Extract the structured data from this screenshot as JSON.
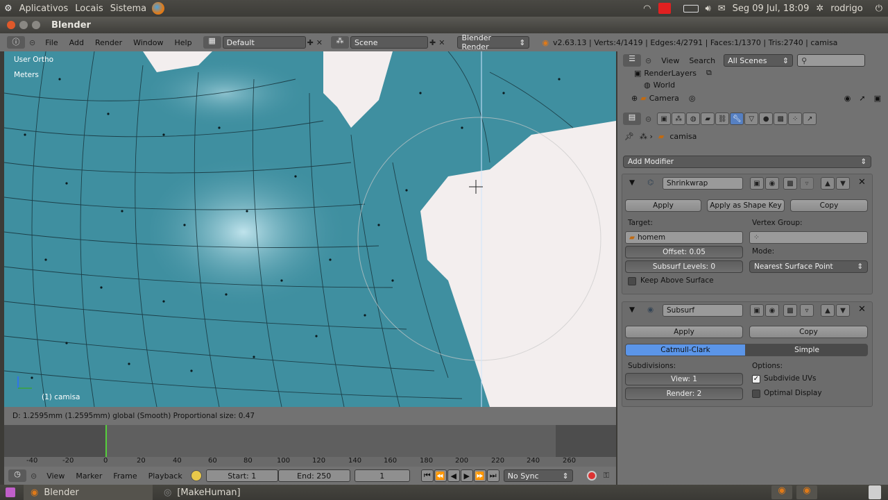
{
  "top_panel": {
    "menus": [
      "Aplicativos",
      "Locais",
      "Sistema"
    ],
    "datetime": "Seg 09 Jul, 18:09",
    "user": "rodrigo"
  },
  "window": {
    "title": "Blender"
  },
  "info_header": {
    "menus": [
      "File",
      "Add",
      "Render",
      "Window",
      "Help"
    ],
    "layout": "Default",
    "scene": "Scene",
    "engine": "Blender Render",
    "stats": "v2.63.13 | Verts:4/1419 | Edges:4/2791 | Faces:1/1370 | Tris:2740 | camisa"
  },
  "viewport": {
    "view_label": "User Ortho",
    "units_label": "Meters",
    "object_label": "(1) camisa",
    "status_text": "D: 1.2595mm  (1.2595mm) global (Smooth)   Proportional size: 0.47",
    "colors": {
      "mesh": "#3f8fa0",
      "body": "#f2ecec"
    }
  },
  "timeline": {
    "ticks": [
      "-40",
      "-20",
      "0",
      "20",
      "40",
      "60",
      "80",
      "100",
      "120",
      "140",
      "160",
      "180",
      "200",
      "220",
      "240",
      "260"
    ],
    "menus": [
      "View",
      "Marker",
      "Frame",
      "Playback"
    ],
    "start": "Start: 1",
    "end": "End: 250",
    "current": "1",
    "sync": "No Sync",
    "current_frame_value": 1
  },
  "outliner": {
    "menus": [
      "View",
      "Search"
    ],
    "filter": "All Scenes",
    "items": [
      "RenderLayers",
      "World",
      "Camera"
    ]
  },
  "properties": {
    "breadcrumb": "camisa",
    "add_modifier": "Add Modifier",
    "shrinkwrap": {
      "name": "Shrinkwrap",
      "apply": "Apply",
      "apply_shape": "Apply as Shape Key",
      "copy": "Copy",
      "target_label": "Target:",
      "target": "homem",
      "vertex_group_label": "Vertex Group:",
      "offset": "Offset: 0.05",
      "subsurf_levels": "Subsurf Levels: 0",
      "mode_label": "Mode:",
      "mode": "Nearest Surface Point",
      "keep_above": "Keep Above Surface"
    },
    "subsurf": {
      "name": "Subsurf",
      "apply": "Apply",
      "copy": "Copy",
      "catmull": "Catmull-Clark",
      "simple": "Simple",
      "subdivisions_label": "Subdivisions:",
      "view": "View: 1",
      "render": "Render: 2",
      "options_label": "Options:",
      "subdivide_uvs": "Subdivide UVs",
      "optimal_display": "Optimal Display"
    }
  },
  "taskbar": {
    "items": [
      "Blender",
      "[MakeHuman]"
    ]
  }
}
